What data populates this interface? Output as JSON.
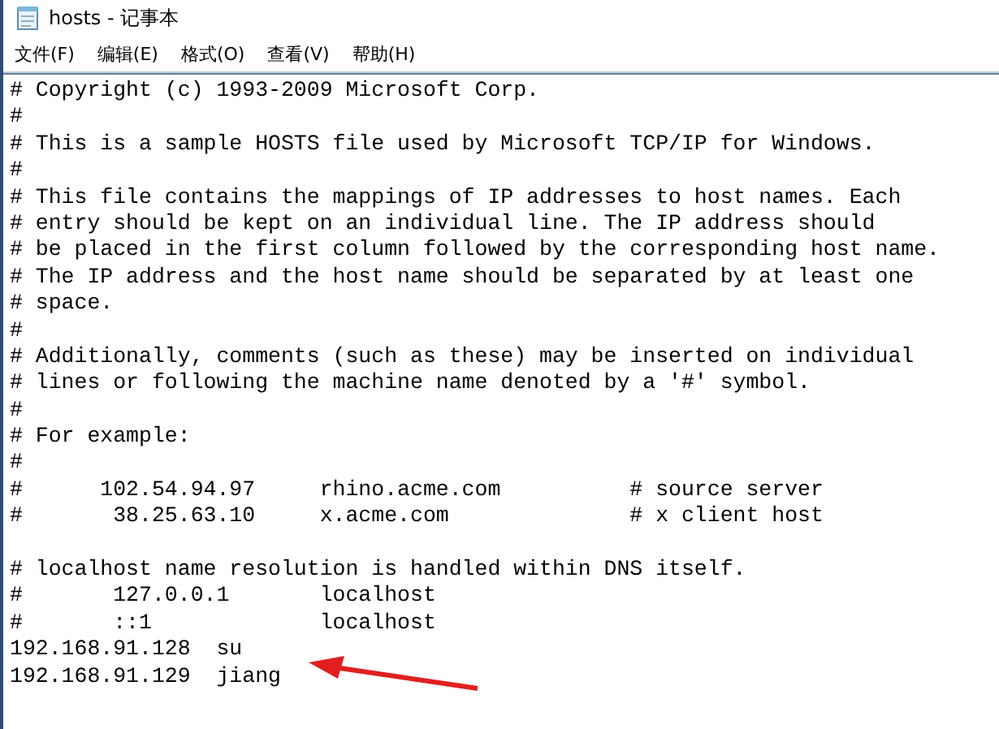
{
  "window": {
    "title": "hosts - 记事本"
  },
  "menu": [
    "文件(F)",
    "编辑(E)",
    "格式(O)",
    "查看(V)",
    "帮助(H)"
  ],
  "editor": {
    "blocks": [
      [
        "# Copyright (c) 1993-2009 Microsoft Corp.",
        "#",
        "# This is a sample HOSTS file used by Microsoft TCP/IP for Windows.",
        "#",
        "# This file contains the mappings of IP addresses to host names. Each",
        "# entry should be kept on an individual line. The IP address should",
        "# be placed in the first column followed by the corresponding host name.",
        "# The IP address and the host name should be separated by at least one",
        "# space.",
        "#",
        "# Additionally, comments (such as these) may be inserted on individual",
        "# lines or following the machine name denoted by a '#' symbol.",
        "#",
        "# For example:",
        "#",
        "#      102.54.94.97     rhino.acme.com          # source server",
        "#       38.25.63.10     x.acme.com              # x client host"
      ],
      [
        "# localhost name resolution is handled within DNS itself.",
        "#       127.0.0.1       localhost",
        "#       ::1             localhost",
        "192.168.91.128  su",
        "192.168.91.129  jiang"
      ]
    ]
  }
}
